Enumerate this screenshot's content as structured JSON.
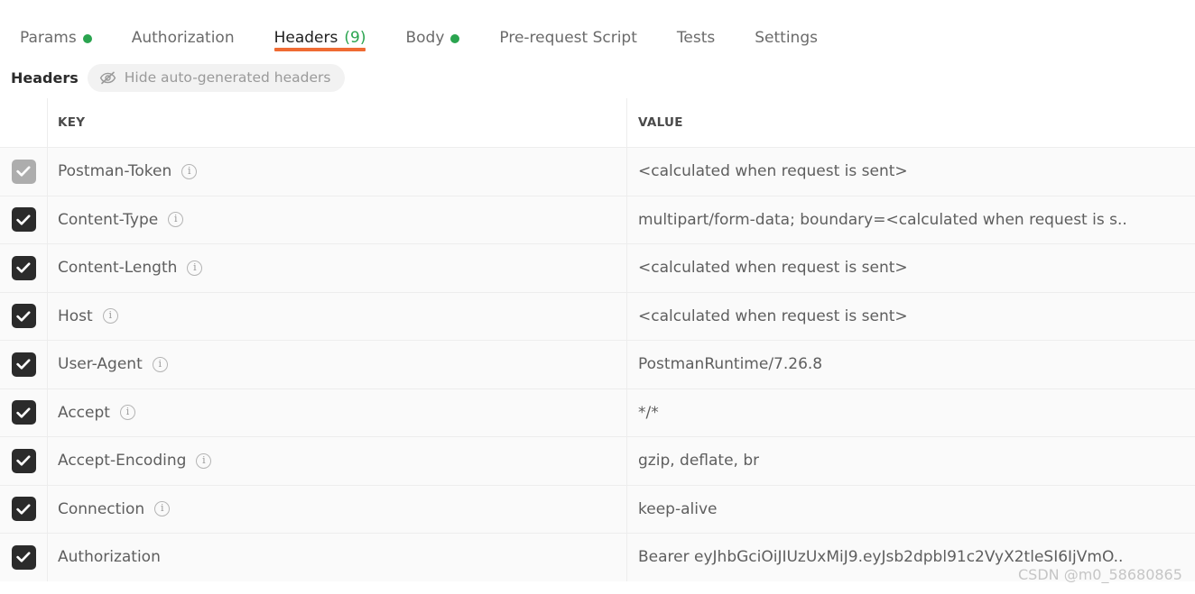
{
  "tabs": [
    {
      "label": "Params",
      "dot": true,
      "count": null,
      "active": false
    },
    {
      "label": "Authorization",
      "dot": false,
      "count": null,
      "active": false
    },
    {
      "label": "Headers",
      "dot": false,
      "count": "(9)",
      "active": true
    },
    {
      "label": "Body",
      "dot": true,
      "count": null,
      "active": false
    },
    {
      "label": "Pre-request Script",
      "dot": false,
      "count": null,
      "active": false
    },
    {
      "label": "Tests",
      "dot": false,
      "count": null,
      "active": false
    },
    {
      "label": "Settings",
      "dot": false,
      "count": null,
      "active": false
    }
  ],
  "subheader": {
    "title": "Headers",
    "toggle_label": "Hide auto-generated headers",
    "toggle_icon": "eye-slash-icon"
  },
  "table": {
    "columns": {
      "key": "KEY",
      "value": "VALUE"
    },
    "rows": [
      {
        "checked": true,
        "disabled": true,
        "info": true,
        "key": "Postman-Token",
        "value": "<calculated when request is sent>"
      },
      {
        "checked": true,
        "disabled": false,
        "info": true,
        "key": "Content-Type",
        "value": "multipart/form-data; boundary=<calculated when request is s.."
      },
      {
        "checked": true,
        "disabled": false,
        "info": true,
        "key": "Content-Length",
        "value": "<calculated when request is sent>"
      },
      {
        "checked": true,
        "disabled": false,
        "info": true,
        "key": "Host",
        "value": "<calculated when request is sent>"
      },
      {
        "checked": true,
        "disabled": false,
        "info": true,
        "key": "User-Agent",
        "value": "PostmanRuntime/7.26.8"
      },
      {
        "checked": true,
        "disabled": false,
        "info": true,
        "key": "Accept",
        "value": "*/*"
      },
      {
        "checked": true,
        "disabled": false,
        "info": true,
        "key": "Accept-Encoding",
        "value": "gzip, deflate, br"
      },
      {
        "checked": true,
        "disabled": false,
        "info": true,
        "key": "Connection",
        "value": "keep-alive"
      },
      {
        "checked": true,
        "disabled": false,
        "info": false,
        "key": "Authorization",
        "value": "Bearer eyJhbGciOiJIUzUxMiJ9.eyJsb2dpbl91c2VyX2tleSI6IjVmO.."
      }
    ]
  },
  "watermark": {
    "text": "CSDN @m0_58680865"
  },
  "colors": {
    "accent_underline": "#EF6B33",
    "badge_green": "#2AA44F",
    "checkbox_on": "#2B2B2B",
    "checkbox_disabled": "#ADADAD",
    "row_bg": "#FAFAFA",
    "border": "#EDEDED"
  }
}
